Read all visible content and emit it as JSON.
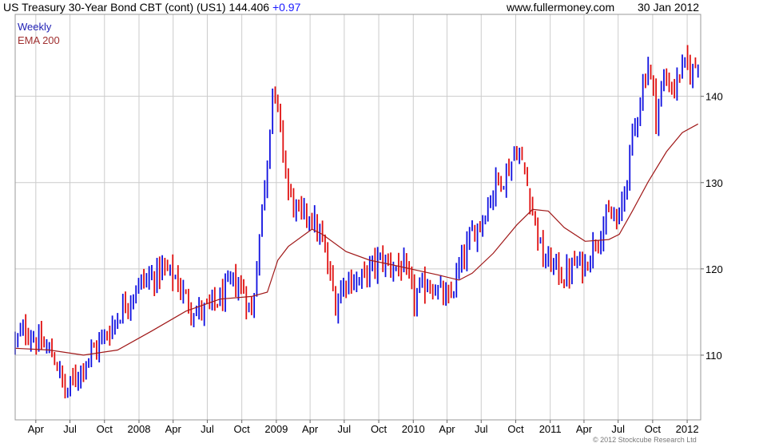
{
  "header": {
    "title": "US Treasury 30-Year  Bond CBT (cont) (US1)",
    "last": "144.406",
    "change": "+0.97",
    "site": "www.fullermoney.com",
    "date": "30 Jan 2012"
  },
  "copyright": "© 2012 Stockcube Research Ltd",
  "colors": {
    "up": "#1010e0",
    "down": "#e01010",
    "ema": "#a01818",
    "grid": "#cccccc",
    "legend_weekly": "#1f1fb4",
    "legend_ema": "#a03030"
  },
  "chart_data": {
    "type": "candlestick",
    "title": "US Treasury 30-Year  Bond CBT (cont) (US1)",
    "frequency": "Weekly",
    "legend": [
      "Weekly",
      "EMA 200"
    ],
    "ylim": [
      102.5,
      149.5
    ],
    "y_ticks": [
      110,
      120,
      130,
      140
    ],
    "y_axis_side": "right",
    "x_ticks": [
      "Apr",
      "Jul",
      "Oct",
      "2008",
      "Apr",
      "Jul",
      "Oct",
      "2009",
      "Apr",
      "Jul",
      "Oct",
      "2010",
      "Apr",
      "Jul",
      "Oct",
      "2011",
      "Apr",
      "Jul",
      "Oct",
      "2012"
    ],
    "x_range": [
      "2007-02-05",
      "2012-02-06"
    ],
    "grid": true,
    "weekly_closes": [
      [
        "2007-02-05",
        111.5
      ],
      [
        "2007-03-05",
        113.0
      ],
      [
        "2007-04-02",
        111.6
      ],
      [
        "2007-05-07",
        110.5
      ],
      [
        "2007-05-28",
        109.0
      ],
      [
        "2007-06-18",
        105.5
      ],
      [
        "2007-07-09",
        107.0
      ],
      [
        "2007-08-13",
        109.5
      ],
      [
        "2007-09-10",
        111.0
      ],
      [
        "2007-10-08",
        112.5
      ],
      [
        "2007-11-05",
        114.5
      ],
      [
        "2007-12-03",
        116.5
      ],
      [
        "2008-01-07",
        118.5
      ],
      [
        "2008-02-04",
        119.0
      ],
      [
        "2008-03-03",
        120.0
      ],
      [
        "2008-04-07",
        119.0
      ],
      [
        "2008-05-05",
        116.5
      ],
      [
        "2008-06-02",
        115.0
      ],
      [
        "2008-07-07",
        115.5
      ],
      [
        "2008-08-04",
        116.5
      ],
      [
        "2008-09-08",
        118.5
      ],
      [
        "2008-10-06",
        117.5
      ],
      [
        "2008-10-27",
        114.5
      ],
      [
        "2008-11-17",
        124.0
      ],
      [
        "2008-12-08",
        133.0
      ],
      [
        "2008-12-22",
        141.0
      ],
      [
        "2009-01-12",
        136.0
      ],
      [
        "2009-02-02",
        129.0
      ],
      [
        "2009-03-02",
        126.0
      ],
      [
        "2009-03-30",
        126.5
      ],
      [
        "2009-05-04",
        123.0
      ],
      [
        "2009-06-08",
        116.0
      ],
      [
        "2009-07-06",
        119.0
      ],
      [
        "2009-08-10",
        118.5
      ],
      [
        "2009-09-07",
        120.0
      ],
      [
        "2009-10-05",
        121.0
      ],
      [
        "2009-11-02",
        120.5
      ],
      [
        "2009-12-07",
        120.0
      ],
      [
        "2010-01-04",
        116.5
      ],
      [
        "2010-02-08",
        118.5
      ],
      [
        "2010-03-08",
        117.5
      ],
      [
        "2010-04-05",
        116.0
      ],
      [
        "2010-05-03",
        120.0
      ],
      [
        "2010-06-07",
        124.0
      ],
      [
        "2010-07-05",
        126.0
      ],
      [
        "2010-08-09",
        130.0
      ],
      [
        "2010-09-06",
        131.0
      ],
      [
        "2010-10-04",
        134.0
      ],
      [
        "2010-10-25",
        131.0
      ],
      [
        "2010-11-15",
        127.0
      ],
      [
        "2010-12-13",
        121.0
      ],
      [
        "2011-01-10",
        120.5
      ],
      [
        "2011-02-07",
        119.0
      ],
      [
        "2011-03-07",
        120.5
      ],
      [
        "2011-04-04",
        120.5
      ],
      [
        "2011-05-02",
        123.5
      ],
      [
        "2011-06-06",
        126.0
      ],
      [
        "2011-07-04",
        125.5
      ],
      [
        "2011-08-08",
        135.0
      ],
      [
        "2011-08-29",
        140.0
      ],
      [
        "2011-09-19",
        144.0
      ],
      [
        "2011-10-10",
        138.0
      ],
      [
        "2011-10-31",
        142.0
      ],
      [
        "2011-11-28",
        141.0
      ],
      [
        "2011-12-19",
        143.5
      ],
      [
        "2012-01-16",
        143.0
      ],
      [
        "2012-01-30",
        144.4
      ]
    ],
    "ema_200": [
      [
        "2007-02-05",
        110.8
      ],
      [
        "2007-05-07",
        110.6
      ],
      [
        "2007-08-06",
        110.0
      ],
      [
        "2007-11-05",
        110.6
      ],
      [
        "2008-02-04",
        112.8
      ],
      [
        "2008-05-05",
        115.1
      ],
      [
        "2008-08-04",
        116.5
      ],
      [
        "2008-10-27",
        116.8
      ],
      [
        "2008-12-08",
        117.3
      ],
      [
        "2009-01-05",
        121.0
      ],
      [
        "2009-02-02",
        122.6
      ],
      [
        "2009-04-06",
        124.6
      ],
      [
        "2009-05-04",
        124.0
      ],
      [
        "2009-07-06",
        122.0
      ],
      [
        "2009-09-07",
        121.0
      ],
      [
        "2009-11-02",
        120.5
      ],
      [
        "2010-01-04",
        119.9
      ],
      [
        "2010-03-08",
        119.3
      ],
      [
        "2010-05-03",
        118.7
      ],
      [
        "2010-06-07",
        119.5
      ],
      [
        "2010-08-02",
        121.8
      ],
      [
        "2010-10-04",
        125.1
      ],
      [
        "2010-11-15",
        126.9
      ],
      [
        "2010-12-27",
        126.7
      ],
      [
        "2011-02-07",
        124.8
      ],
      [
        "2011-04-04",
        123.2
      ],
      [
        "2011-06-06",
        123.4
      ],
      [
        "2011-07-04",
        124.0
      ],
      [
        "2011-08-08",
        126.7
      ],
      [
        "2011-09-19",
        130.1
      ],
      [
        "2011-11-07",
        133.6
      ],
      [
        "2011-12-19",
        135.8
      ],
      [
        "2012-01-30",
        136.8
      ]
    ]
  }
}
